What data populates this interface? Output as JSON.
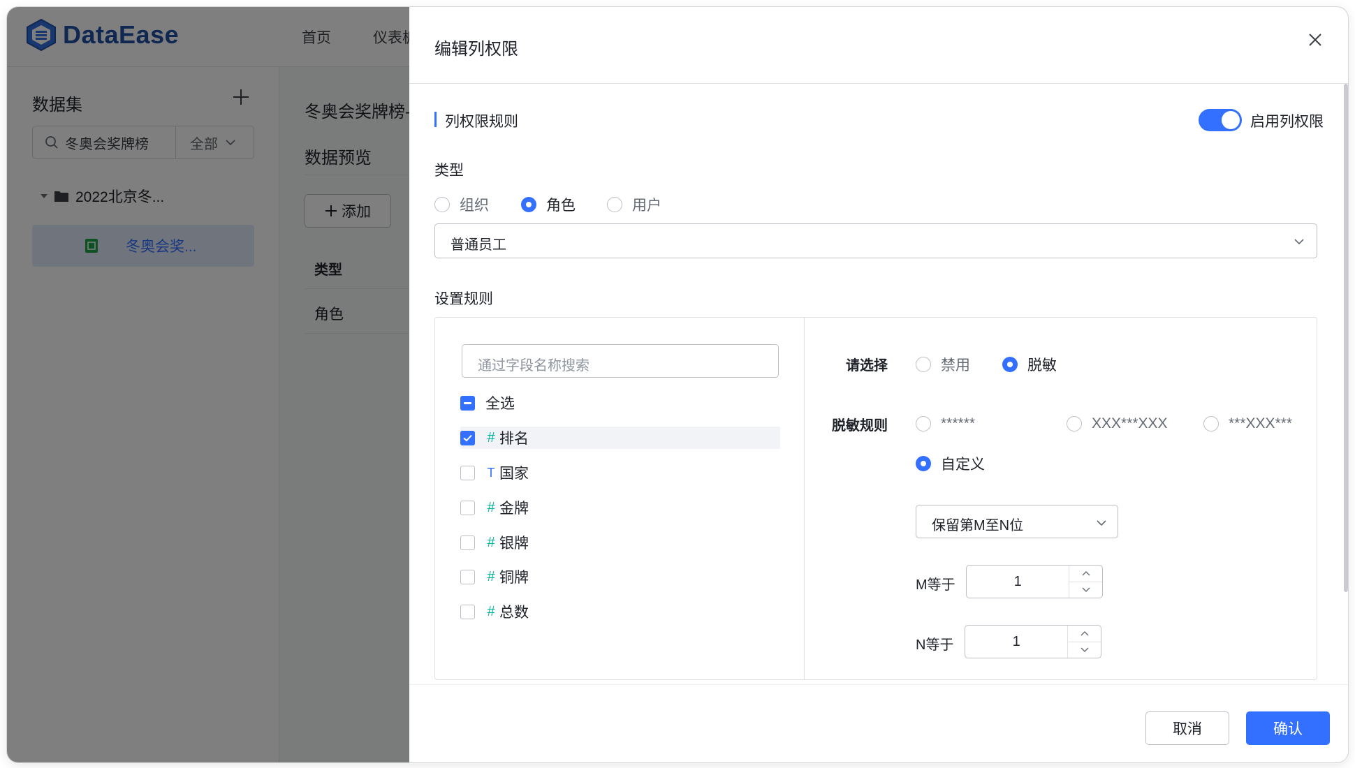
{
  "app": {
    "logo_text": "DataEase",
    "nav": [
      "首页",
      "仪表板"
    ]
  },
  "sidebar": {
    "title": "数据集",
    "search_value": "冬奥会奖牌榜",
    "filter_label": "全部",
    "folder_label": "2022北京冬...",
    "dataset_label": "冬奥会奖..."
  },
  "content": {
    "title": "冬奥会奖牌榜-",
    "tab": "数据预览",
    "add_label": "添加",
    "table_header": "类型",
    "table_cell": "角色"
  },
  "drawer": {
    "title": "编辑列权限",
    "section_title": "列权限规则",
    "switch_label": "启用列权限",
    "switch_on": true,
    "type_label": "类型",
    "type_options": [
      "组织",
      "角色",
      "用户"
    ],
    "type_selected": "角色",
    "target_value": "普通员工",
    "rules_label": "设置规则",
    "field_search_placeholder": "通过字段名称搜索",
    "select_all_label": "全选",
    "fields": [
      {
        "type": "#",
        "name": "排名",
        "checked": true
      },
      {
        "type": "T",
        "name": "国家",
        "checked": false
      },
      {
        "type": "#",
        "name": "金牌",
        "checked": false
      },
      {
        "type": "#",
        "name": "银牌",
        "checked": false
      },
      {
        "type": "#",
        "name": "铜牌",
        "checked": false
      },
      {
        "type": "#",
        "name": "总数",
        "checked": false
      }
    ],
    "choose_label": "请选择",
    "choose_options": [
      "禁用",
      "脱敏"
    ],
    "choose_selected": "脱敏",
    "mask_label": "脱敏规则",
    "mask_options": [
      "******",
      "XXX***XXX",
      "***XXX***",
      "自定义"
    ],
    "mask_selected": "自定义",
    "custom_rule_value": "保留第M至N位",
    "m_label": "M等于",
    "m_value": "1",
    "n_label": "N等于",
    "n_value": "1",
    "cancel_label": "取消",
    "confirm_label": "确认"
  },
  "colors": {
    "primary": "#3370ff",
    "brand": "#1e4fa3",
    "number_field": "#04b49c"
  },
  "icons": [
    "search-icon",
    "plus-icon",
    "chevron-down-icon",
    "folder-icon",
    "file-icon",
    "close-icon",
    "check-icon",
    "arrow-up-icon",
    "arrow-down-icon"
  ]
}
